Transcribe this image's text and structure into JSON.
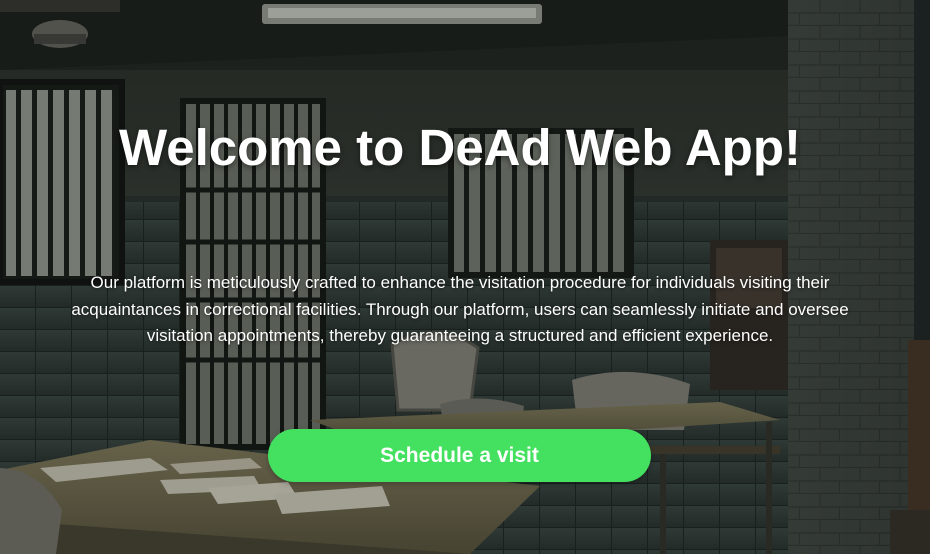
{
  "hero": {
    "title": "Welcome to DeAd Web App!",
    "description": "Our platform is meticulously crafted to enhance the visitation procedure for individuals visiting their acquaintances in correctional facilities. Through our platform, users can seamlessly initiate and oversee visitation appointments, thereby guaranteeing a structured and efficient experience.",
    "cta_label": "Schedule a visit",
    "background": "photo of a dim visitation room with barred windows, tables and folding chairs"
  },
  "colors": {
    "accent": "#44e060",
    "text": "#ffffff"
  }
}
